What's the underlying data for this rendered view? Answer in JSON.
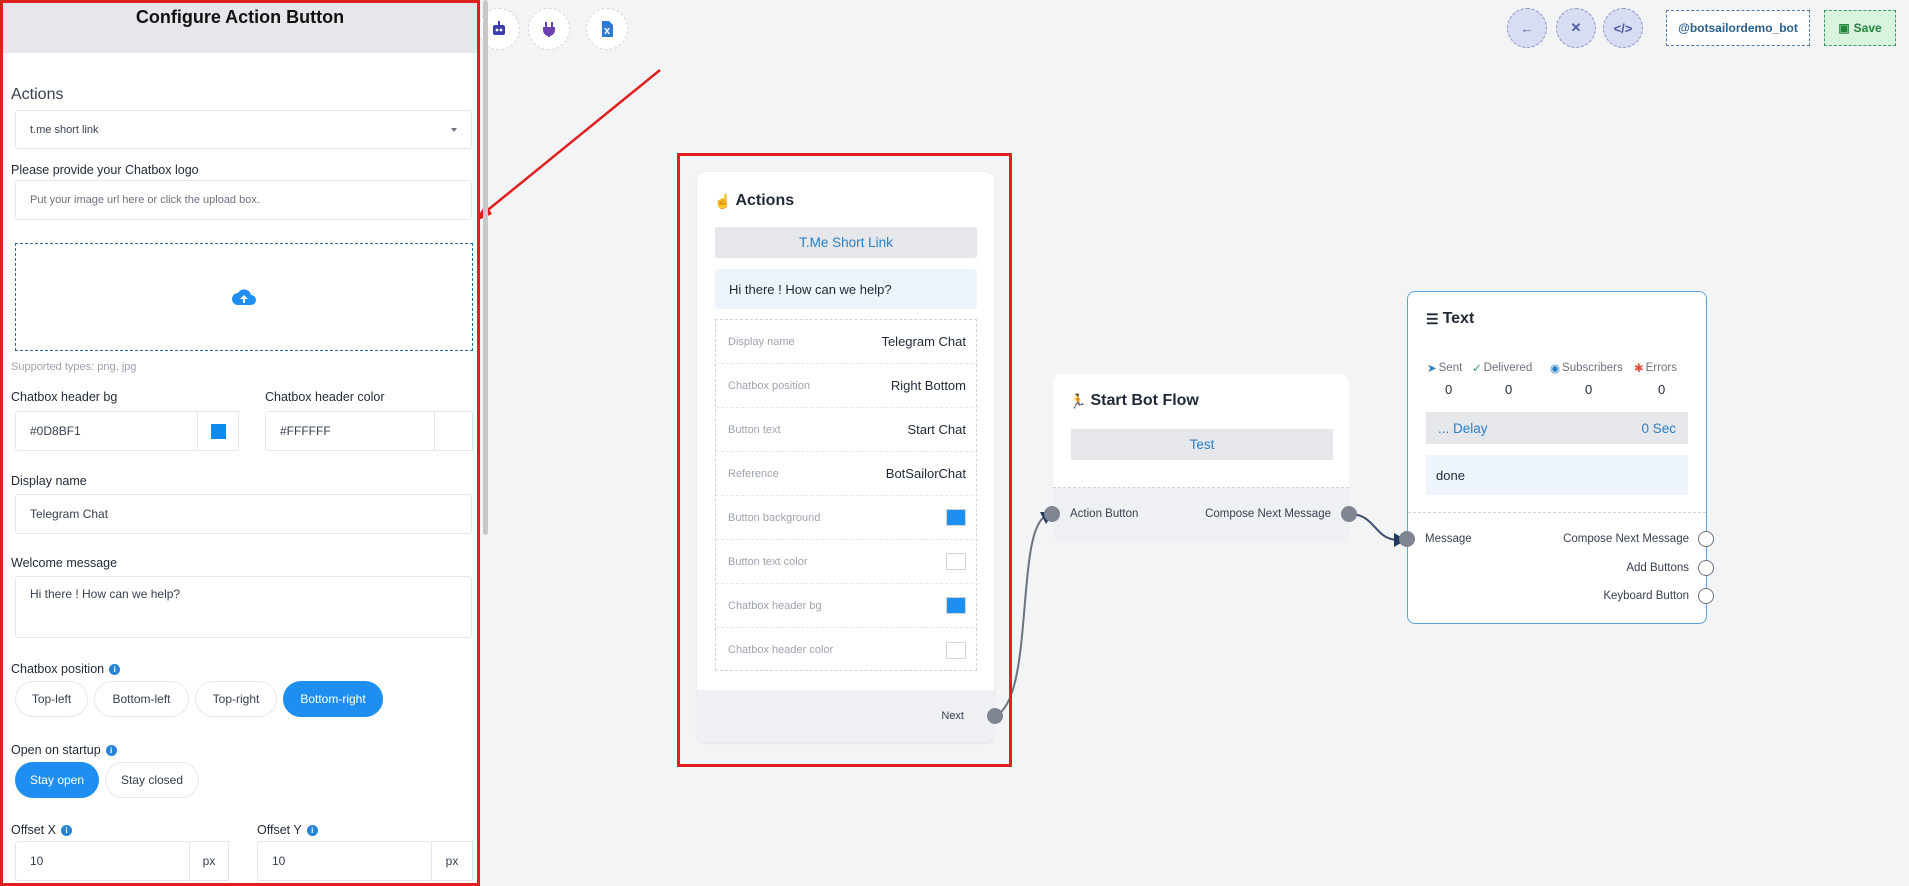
{
  "toolbar": {
    "bot_handle": "@botsailordemo_bot",
    "save_label": "Save",
    "icons": [
      "robot-icon",
      "plugin-icon",
      "excel-icon"
    ],
    "nav": [
      "arrow-left-icon",
      "collapse-icon",
      "code-icon"
    ]
  },
  "panel": {
    "title": "Configure Action Button",
    "actions_heading": "Actions",
    "action_select_value": "t.me short link",
    "logo_label": "Please provide your Chatbox logo",
    "logo_placeholder": "Put your image url here or click the upload box.",
    "supported_types": "Supported types: png, jpg",
    "header_bg_label": "Chatbox header bg",
    "header_bg_value": "#0D8BF1",
    "header_color_label": "Chatbox header color",
    "header_color_value": "#FFFFFF",
    "display_name_label": "Display name",
    "display_name_value": "Telegram Chat",
    "welcome_label": "Welcome message",
    "welcome_value": "Hi there ! How can we help?",
    "position_label": "Chatbox position",
    "positions": [
      "Top-left",
      "Bottom-left",
      "Top-right",
      "Bottom-right"
    ],
    "position_selected": "Bottom-right",
    "startup_label": "Open on startup",
    "startup_options": [
      "Stay open",
      "Stay closed"
    ],
    "startup_selected": "Stay open",
    "offset_x_label": "Offset X",
    "offset_x_value": "10",
    "offset_y_label": "Offset Y",
    "offset_y_value": "10",
    "unit": "px"
  },
  "action_card": {
    "title": "Actions",
    "button_label": "T.Me Short Link",
    "welcome": "Hi there ! How can we help?",
    "props": [
      {
        "key": "Display name",
        "value": "Telegram Chat"
      },
      {
        "key": "Chatbox position",
        "value": "Right Bottom"
      },
      {
        "key": "Button text",
        "value": "Start Chat"
      },
      {
        "key": "Reference",
        "value": "BotSailorChat"
      },
      {
        "key": "Button background",
        "value": ""
      },
      {
        "key": "Button text color",
        "value": ""
      },
      {
        "key": "Chatbox header bg",
        "value": ""
      },
      {
        "key": "Chatbox header color",
        "value": ""
      }
    ],
    "next_label": "Next"
  },
  "flow_card": {
    "title": "Start Bot Flow",
    "test_label": "Test",
    "input_port": "Action Button",
    "output_port": "Compose Next Message"
  },
  "text_card": {
    "title": "Text",
    "stats": [
      {
        "label": "Sent",
        "value": "0"
      },
      {
        "label": "Delivered",
        "value": "0"
      },
      {
        "label": "Subscribers",
        "value": "0"
      },
      {
        "label": "Errors",
        "value": "0"
      }
    ],
    "delay_label": "... Delay",
    "delay_value": "0 Sec",
    "message": "done",
    "input_port": "Message",
    "outputs": [
      "Compose Next Message",
      "Add Buttons",
      "Keyboard Button"
    ]
  },
  "colors": {
    "accent": "#1E8FF0",
    "header_bg_swatch": "#0D8BF1",
    "highlight_frame": "#E02020"
  }
}
